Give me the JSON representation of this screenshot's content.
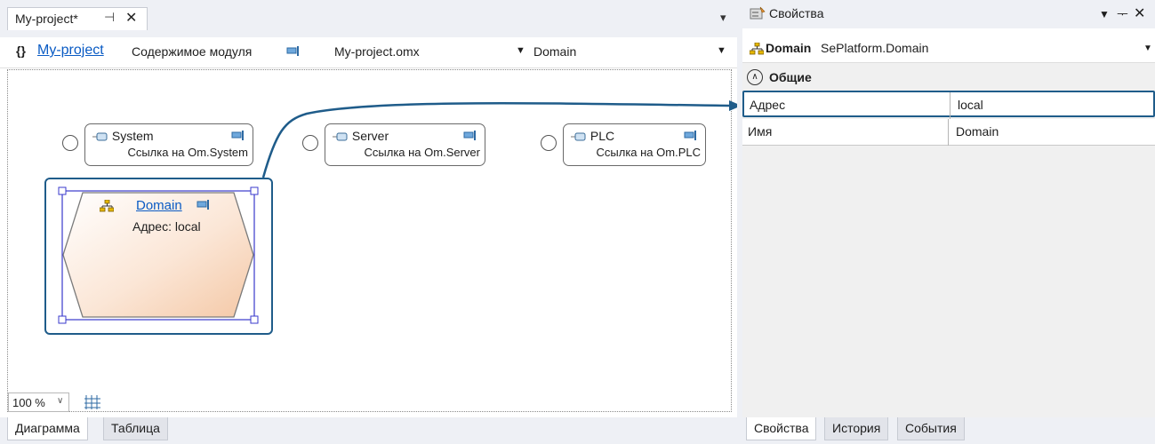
{
  "document": {
    "tab_label": "My-project*",
    "pin_glyph": "⊣",
    "close_glyph": "✕",
    "menu_glyph": "▾",
    "braces": "{}",
    "project_link": "My-project",
    "module_contents": "Содержимое модуля",
    "file_select": "My-project.omx",
    "domain_select": "Domain"
  },
  "diagram": {
    "nodes": [
      {
        "title": "System",
        "subtitle": "Ссылка на Om.System"
      },
      {
        "title": "Server",
        "subtitle": "Ссылка на Om.Server"
      },
      {
        "title": "PLC",
        "subtitle": "Ссылка на Om.PLC"
      }
    ],
    "domain": {
      "title": "Domain",
      "subtitle": "Адрес: local"
    },
    "zoom": "100 %",
    "tabs": [
      "Диаграмма",
      "Таблица"
    ]
  },
  "properties": {
    "title": "Свойства",
    "object_name": "Domain",
    "object_type": "SePlatform.Domain",
    "category": "Общие",
    "rows": [
      {
        "name": "Адрес",
        "value": "local"
      },
      {
        "name": "Имя",
        "value": "Domain"
      }
    ],
    "tabs": [
      "Свойства",
      "История",
      "События"
    ]
  },
  "colors": {
    "accent": "#1f5c8a",
    "link": "#0a5bc4",
    "selection": "#3a3acc",
    "panel": "#eef0f5"
  }
}
